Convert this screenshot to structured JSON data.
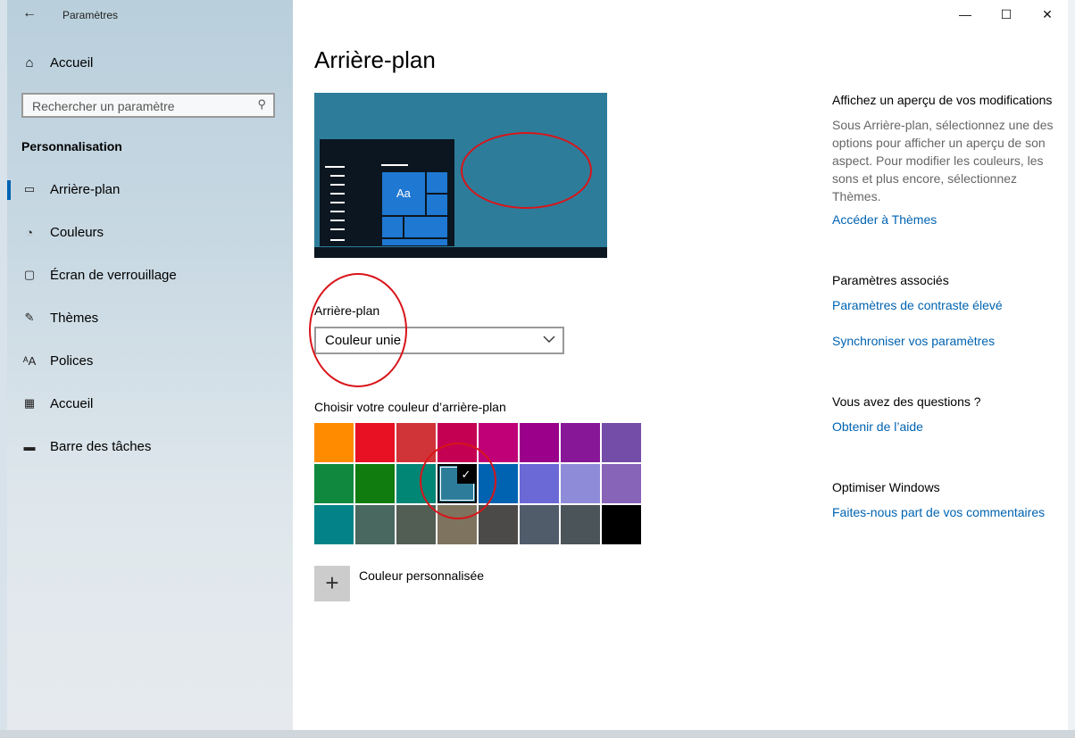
{
  "window": {
    "title": "Paramètres",
    "buttons": [
      "—",
      "☐",
      "✕"
    ]
  },
  "sidebar": {
    "home_label": "Accueil",
    "search_placeholder": "Rechercher un paramètre",
    "section": "Personnalisation",
    "items": [
      {
        "label": "Arrière-plan",
        "icon": "image-icon",
        "active": true
      },
      {
        "label": "Couleurs",
        "icon": "palette-icon",
        "active": false
      },
      {
        "label": "Écran de verrouillage",
        "icon": "lock-screen-icon",
        "active": false
      },
      {
        "label": "Thèmes",
        "icon": "theme-icon",
        "active": false
      },
      {
        "label": "Polices",
        "icon": "font-icon",
        "active": false
      },
      {
        "label": "Accueil",
        "icon": "start-icon",
        "active": false
      },
      {
        "label": "Barre des tâches",
        "icon": "taskbar-icon",
        "active": false
      }
    ]
  },
  "main": {
    "title": "Arrière-plan",
    "preview_tile_text": "Aa",
    "background_label": "Arrière-plan",
    "background_value": "Couleur unie",
    "color_label": "Choisir votre couleur d’arrière-plan",
    "colors": [
      "#ff8c00",
      "#e81123",
      "#d13438",
      "#c30052",
      "#bf0077",
      "#9a0089",
      "#881798",
      "#744da9",
      "#10893e",
      "#107c10",
      "#018574",
      "#2d7d9a",
      "#0063b1",
      "#6b69d6",
      "#8e8cd8",
      "#8764b8",
      "#038387",
      "#486860",
      "#525e54",
      "#7e735f",
      "#4c4a48",
      "#515c6b",
      "#4a5459",
      "#000000"
    ],
    "selected_color_index": 11,
    "custom_color_label": "Couleur personnalisée"
  },
  "right": {
    "preview_heading": "Affichez un aperçu de vos modifications",
    "preview_text": "Sous Arrière-plan, sélectionnez une des options pour afficher un aperçu de son aspect. Pour modifier les couleurs, les sons et plus encore, sélectionnez Thèmes.",
    "themes_link": "Accéder à Thèmes",
    "related_heading": "Paramètres associés",
    "contrast_link": "Paramètres de contraste élevé",
    "sync_link": "Synchroniser vos paramètres",
    "questions_heading": "Vous avez des questions ?",
    "help_link": "Obtenir de l’aide",
    "optimize_heading": "Optimiser Windows",
    "feedback_link": "Faites-nous part de vos commentaires"
  },
  "annotation_color": "#d8151a"
}
